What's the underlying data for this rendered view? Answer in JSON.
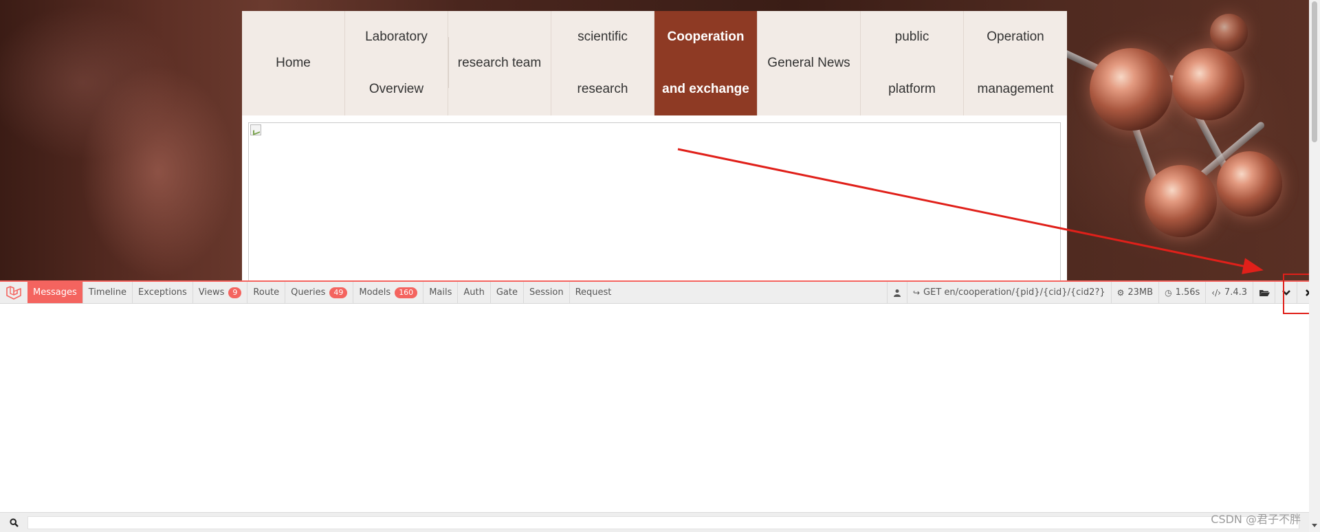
{
  "nav": {
    "items": [
      {
        "lines": [
          "Home"
        ]
      },
      {
        "lines": [
          "Laboratory",
          "Overview"
        ]
      },
      {
        "lines": [
          "research team"
        ]
      },
      {
        "lines": [
          "scientific",
          "research"
        ]
      },
      {
        "lines": [
          "Cooperation",
          "and exchange"
        ]
      },
      {
        "lines": [
          "General News"
        ]
      },
      {
        "lines": [
          "public",
          "platform"
        ]
      },
      {
        "lines": [
          "Operation",
          "management"
        ]
      }
    ],
    "active_index": 4
  },
  "debugbar": {
    "tabs": [
      {
        "label": "Messages",
        "active": true
      },
      {
        "label": "Timeline"
      },
      {
        "label": "Exceptions"
      },
      {
        "label": "Views",
        "badge": "9"
      },
      {
        "label": "Route"
      },
      {
        "label": "Queries",
        "badge": "49"
      },
      {
        "label": "Models",
        "badge": "160"
      },
      {
        "label": "Mails"
      },
      {
        "label": "Auth"
      },
      {
        "label": "Gate"
      },
      {
        "label": "Session"
      },
      {
        "label": "Request"
      }
    ],
    "route": "GET en/cooperation/{pid}/{cid}/{cid2?}",
    "memory": "23MB",
    "time": "1.56s",
    "php_version": "7.4.3",
    "accent_color": "#f4645f"
  },
  "search": {
    "placeholder": "",
    "value": ""
  },
  "watermark": "CSDN @君子不胖",
  "colors": {
    "nav_active": "#8e3a24",
    "nav_bg": "#f2ebe6",
    "annotation": "#e0201a"
  }
}
